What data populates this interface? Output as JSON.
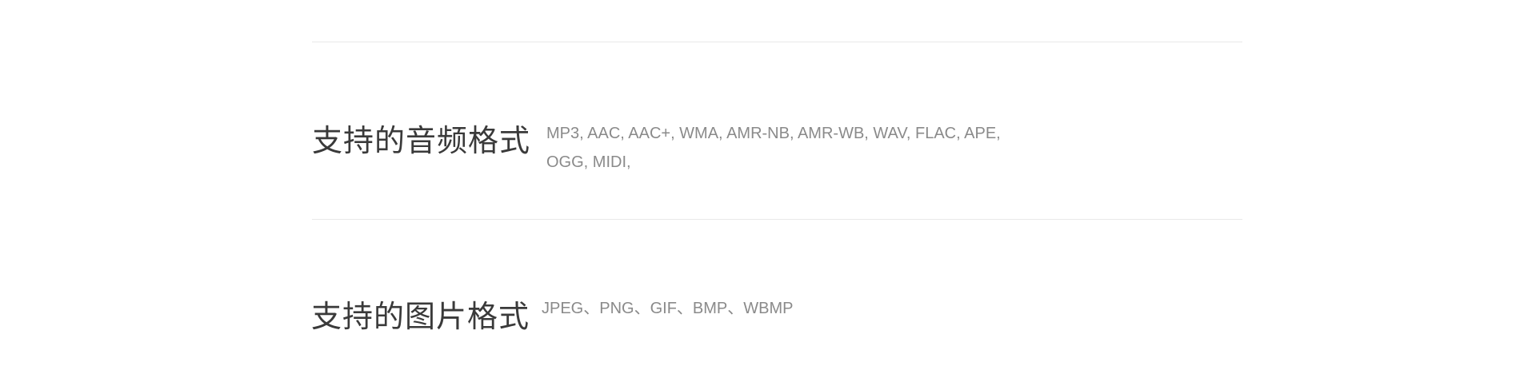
{
  "specs": {
    "audio": {
      "title": "支持的音频格式",
      "value_line1": "MP3, AAC, AAC+, WMA, AMR-NB, AMR-WB, WAV, FLAC, APE,",
      "value_line2": "OGG, MIDI,"
    },
    "image": {
      "title": "支持的图片格式",
      "value": "JPEG、PNG、GIF、BMP、WBMP"
    }
  }
}
